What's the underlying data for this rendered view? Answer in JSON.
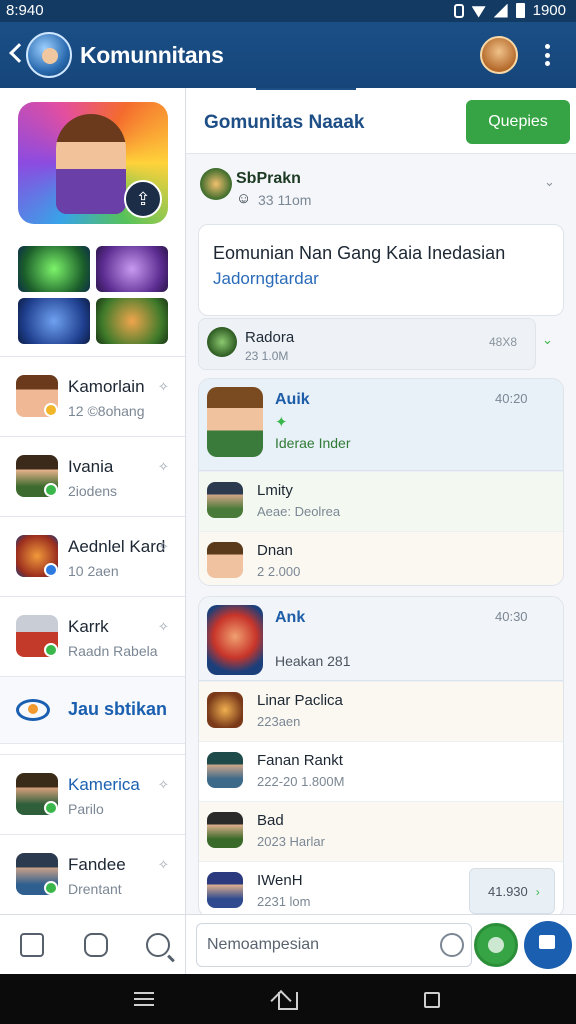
{
  "status": {
    "time": "8:940",
    "clock_right": "1900"
  },
  "app": {
    "title": "Komunnitans"
  },
  "sidebar": {
    "items": [
      {
        "name": "Kamorlain",
        "sub": "12 ©8ohang"
      },
      {
        "name": "Ivania",
        "sub": "2iodens"
      },
      {
        "name": "Aednlel Kard",
        "sub": "10 2aen"
      },
      {
        "name": "Karrk",
        "sub": "Raadn Rabela"
      }
    ],
    "section": {
      "label": "Jau sbtikan"
    },
    "items2": [
      {
        "name": "Kamerica",
        "sub": "Parilo"
      },
      {
        "name": "Fandee",
        "sub": "Drentant"
      }
    ]
  },
  "main": {
    "title": "Gomunitas Naaak",
    "action_label": "Quepies",
    "post": {
      "name": "SbPrakn",
      "meta": "33 11om"
    },
    "notice": {
      "line1": "Eomunian Nan Gang Kaia Inedasian",
      "line2": "Jadorngtardar"
    },
    "mini": {
      "name": "Radora",
      "meta": "23 1.0M",
      "time": "48X8"
    },
    "card1": {
      "name": "Auik",
      "time": "40:20",
      "line": "Iderae Inder",
      "rows": [
        {
          "name": "Lmity",
          "meta": "Aeae: Deolrea"
        },
        {
          "name": "Dnan",
          "meta": "2 2.000"
        }
      ]
    },
    "card2": {
      "name": "Ank",
      "time": "40:30",
      "line": "Heakan  281",
      "rows": [
        {
          "name": "Linar Paclica",
          "meta": "223aen"
        },
        {
          "name": "Fanan Rankt",
          "meta": "222-20 1.800M"
        },
        {
          "name": "Bad",
          "meta": "2023 Harlar"
        },
        {
          "name": "IWenH",
          "meta": "2231 lom",
          "time": "41.930"
        }
      ]
    },
    "composer": {
      "placeholder": "Nemoampesian"
    }
  },
  "icons": [
    "back-icon",
    "bluetooth-icon",
    "wifi-icon",
    "signal-icon",
    "battery-icon",
    "more-icon",
    "pin-icon",
    "chevron-down-icon",
    "chevron-right-icon",
    "emoji-icon",
    "send-icon",
    "chat-icon",
    "controller-icon",
    "search-icon"
  ],
  "colors": {
    "appbar": "#16457a",
    "accent_green": "#36a444",
    "accent_blue": "#1b5fb0"
  }
}
